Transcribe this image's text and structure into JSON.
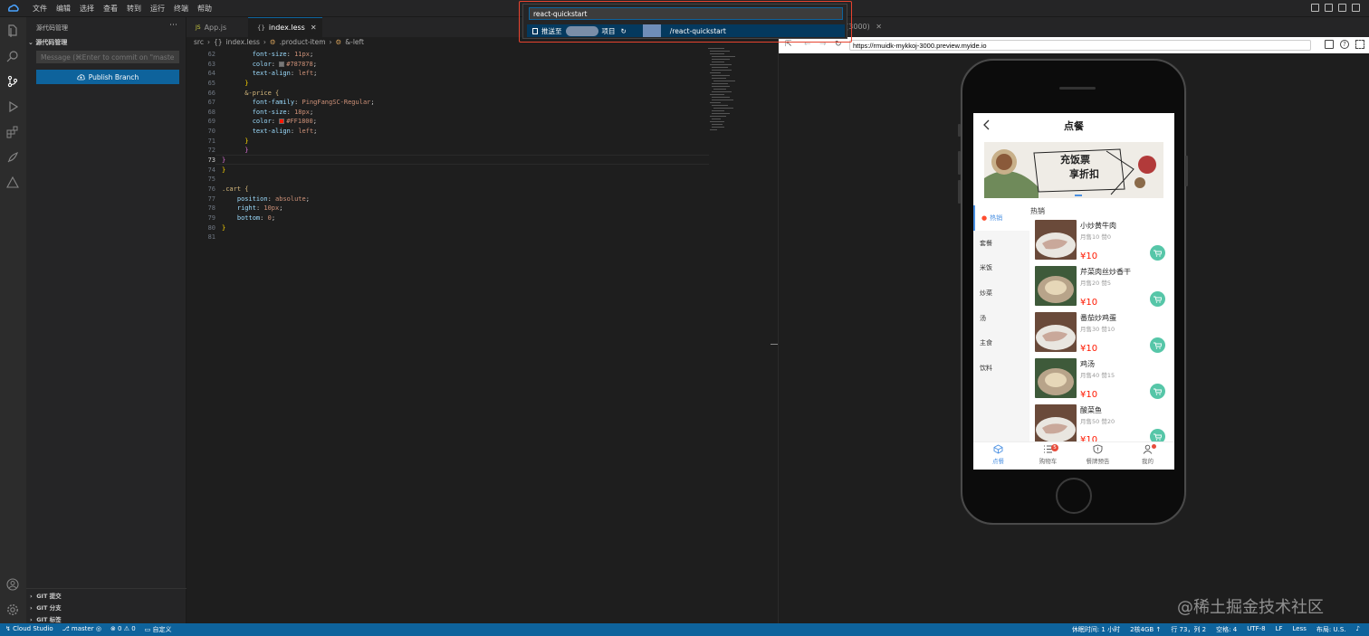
{
  "menubar": {
    "items": [
      "文件",
      "编辑",
      "选择",
      "查看",
      "转到",
      "运行",
      "终端",
      "帮助"
    ]
  },
  "sidebar": {
    "title": "源代码管理",
    "section": "源代码管理",
    "commit_placeholder": "Message (⌘Enter to commit on \"master\")",
    "publish_label": "Publish Branch",
    "git_sections": [
      "GIT 提交",
      "GIT 分支",
      "GIT 标签"
    ]
  },
  "editor": {
    "tabs": [
      {
        "label": "App.js",
        "icon": "JS"
      },
      {
        "label": "index.less",
        "icon": "{}"
      }
    ],
    "breadcrumb": [
      "src",
      "index.less",
      ".product-item",
      "&-left"
    ],
    "line_numbers": [
      "62",
      "63",
      "64",
      "65",
      "66",
      "67",
      "68",
      "69",
      "70",
      "71",
      "72",
      "73",
      "74",
      "75",
      "76",
      "77",
      "78",
      "79",
      "80",
      "81"
    ],
    "current_line": "73",
    "code": {
      "l62": [
        "font-size",
        "11px"
      ],
      "l63": [
        "color",
        "#787878"
      ],
      "l64": [
        "text-align",
        "left"
      ],
      "l65": "}",
      "l66": "&-price {",
      "l67": [
        "font-family",
        "PingFangSC-Regular"
      ],
      "l68": [
        "font-size",
        "18px"
      ],
      "l69": [
        "color",
        "#FF1800"
      ],
      "l70": [
        "text-align",
        "left"
      ],
      "l71": "}",
      "l72": "}",
      "l73": "}",
      "l74": "}",
      "l76": ".cart {",
      "l77": [
        "position",
        "absolute"
      ],
      "l78": [
        "right",
        "10px"
      ],
      "l79": [
        "bottom",
        "0"
      ],
      "l80": "}"
    },
    "swatches": {
      "grey": "#787878",
      "red": "#FF1800"
    }
  },
  "preview": {
    "tab_label": "t(3000)",
    "url": "https://rmuidk-mykkoj-3000.preview.myide.io",
    "app": {
      "title": "点餐",
      "banner_text": [
        "充饭票",
        "享折扣"
      ],
      "categories": [
        "热销",
        "套餐",
        "米饭",
        "炒菜",
        "汤",
        "主食",
        "饮料"
      ],
      "section_label": "热销",
      "products": [
        {
          "name": "小炒黄牛肉",
          "meta": "月售10 赞0",
          "price": "¥10"
        },
        {
          "name": "芹菜肉丝炒香干",
          "meta": "月售20 赞5",
          "price": "¥10"
        },
        {
          "name": "番茄炒鸡蛋",
          "meta": "月售30 赞10",
          "price": "¥10"
        },
        {
          "name": "鸡汤",
          "meta": "月售40 赞15",
          "price": "¥10"
        },
        {
          "name": "酸菜鱼",
          "meta": "月售50 赞20",
          "price": "¥10"
        }
      ],
      "bottom_nav": [
        {
          "label": "点餐",
          "icon": "cube-icon"
        },
        {
          "label": "购物车",
          "icon": "list-icon",
          "badge": "5"
        },
        {
          "label": "餐牌预告",
          "icon": "shield-icon"
        },
        {
          "label": "我的",
          "icon": "user-icon"
        }
      ],
      "accent": "#4a90e2",
      "price_color": "#ff1800",
      "cart_color": "#56c6a8"
    }
  },
  "palette": {
    "input_value": "react-quickstart",
    "item_prefix": "推送至",
    "item_mid": "项目",
    "item_suffix": "/react-quickstart"
  },
  "statusbar": {
    "left": [
      "Cloud Studio",
      "master",
      "⊗ 0 ⚠ 0",
      "自定义"
    ],
    "right": [
      "休眠时间: 1 小时",
      "2核4GB ↑",
      "行 73，列 2",
      "空格: 4",
      "UTF-8",
      "LF",
      "Less",
      "布局: U.S."
    ]
  },
  "watermark": "@稀土掘金技术社区"
}
